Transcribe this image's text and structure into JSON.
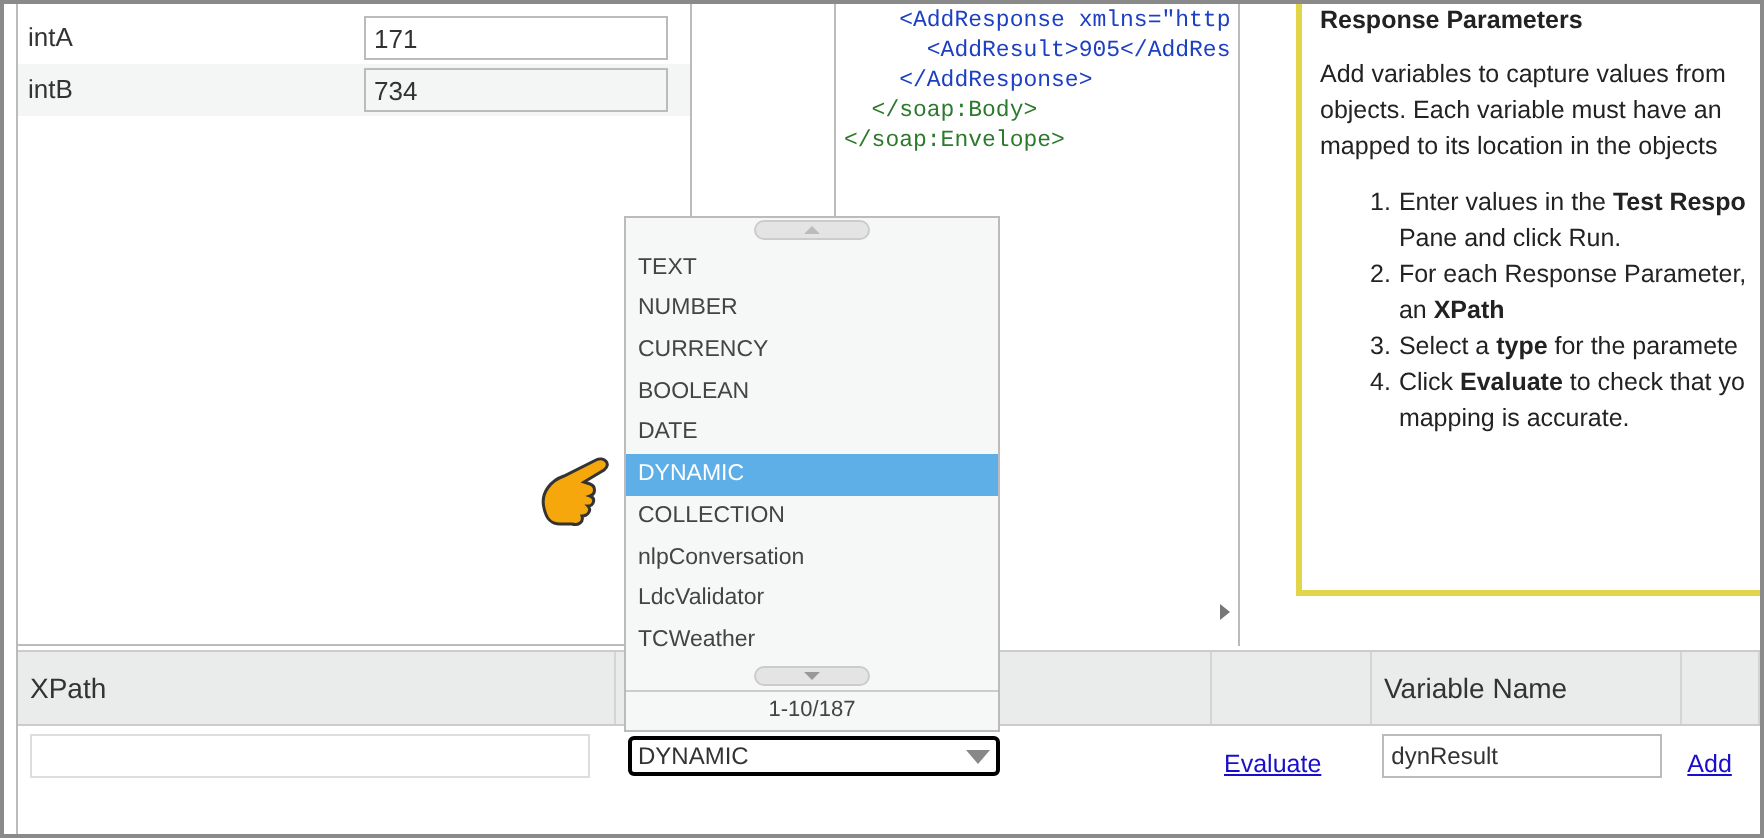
{
  "parameters": [
    {
      "name": "intA",
      "value": "171"
    },
    {
      "name": "intB",
      "value": "734"
    }
  ],
  "response_xml": [
    {
      "text": "    <AddResponse xmlns=\"http",
      "kind": "tag"
    },
    {
      "text": "      <AddResult>905</AddRes",
      "kind": "tag"
    },
    {
      "text": "    </AddResponse>",
      "kind": "tag"
    },
    {
      "text": "  </soap:Body>",
      "kind": "soap"
    },
    {
      "text": "</soap:Envelope>",
      "kind": "soap"
    }
  ],
  "help": {
    "title": "Response Parameters",
    "intro_lines": [
      "Add variables to capture values from",
      "objects. Each variable must have an",
      "mapped to its location in the objects"
    ],
    "steps": [
      {
        "number": "1.",
        "lines": [
          "Enter values in the **Test Respo**",
          "Pane and click Run."
        ]
      },
      {
        "number": "2.",
        "lines": [
          "For each Response Parameter,",
          "an **XPath**"
        ]
      },
      {
        "number": "3.",
        "lines": [
          "Select a **type** for the paramete"
        ]
      },
      {
        "number": "4.",
        "lines": [
          "Click **Evaluate** to check that yo",
          "mapping is accurate."
        ]
      }
    ]
  },
  "table": {
    "columns": [
      "XPath",
      "Variable Name"
    ],
    "row": {
      "type": "DYNAMIC",
      "evaluate": "Evaluate",
      "variable_name": "dynResult",
      "add": "Add"
    }
  },
  "type_dropdown": {
    "options": [
      {
        "label": "TEXT",
        "selected": false
      },
      {
        "label": "NUMBER",
        "selected": false
      },
      {
        "label": "CURRENCY",
        "selected": false
      },
      {
        "label": "BOOLEAN",
        "selected": false
      },
      {
        "label": "DATE",
        "selected": false
      },
      {
        "label": "DYNAMIC",
        "selected": true
      },
      {
        "label": "COLLECTION",
        "selected": false
      },
      {
        "label": "nlpConversation",
        "selected": false
      },
      {
        "label": "LdcValidator",
        "selected": false
      },
      {
        "label": "TCWeather",
        "selected": false
      }
    ],
    "pager": "1-10/187"
  }
}
